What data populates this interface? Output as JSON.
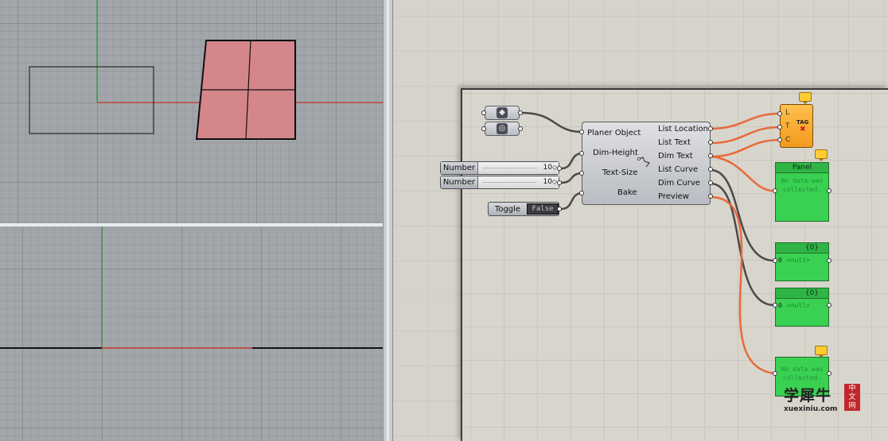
{
  "colors": {
    "grid_bg": "#a2a6ab",
    "x_axis": "#c6392d",
    "y_axis": "#2f9a32",
    "surface_fill": "#d4868b",
    "gh_canvas": "#d8d5cd",
    "wire_orange": "#e8693a",
    "wire_grey": "#4a4a4a",
    "panel_green": "#3ad152",
    "component_orange": "#f6a62a"
  },
  "gh": {
    "params": [
      {
        "icon": "geometry-icon"
      },
      {
        "icon": "curve-icon"
      }
    ],
    "sliders": [
      {
        "label": "Number",
        "value": "10"
      },
      {
        "label": "Number",
        "value": "10"
      }
    ],
    "toggle": {
      "label": "Toggle",
      "state": "False"
    },
    "main_component": {
      "inputs": [
        "Planer Object",
        "Dim-Height",
        "Text-Size",
        "Bake"
      ],
      "outputs": [
        "List Location",
        "List Text",
        "Dim Text",
        "List Curve",
        "Dim Curve",
        "Preview"
      ]
    },
    "tag_component": {
      "inputs": [
        "L",
        "T",
        "C"
      ],
      "title": "TAG"
    },
    "panels": [
      {
        "header": "Panel",
        "text": "No data was collected."
      },
      {
        "header": "{0}",
        "index": "0",
        "text": "<null>"
      },
      {
        "header": "{0}",
        "index": "0",
        "text": "<null>"
      },
      {
        "header": "",
        "text": "No data was collected."
      }
    ]
  },
  "watermark": {
    "cn": "学犀牛",
    "url": "xuexiniu.com",
    "seal": "中文网"
  }
}
